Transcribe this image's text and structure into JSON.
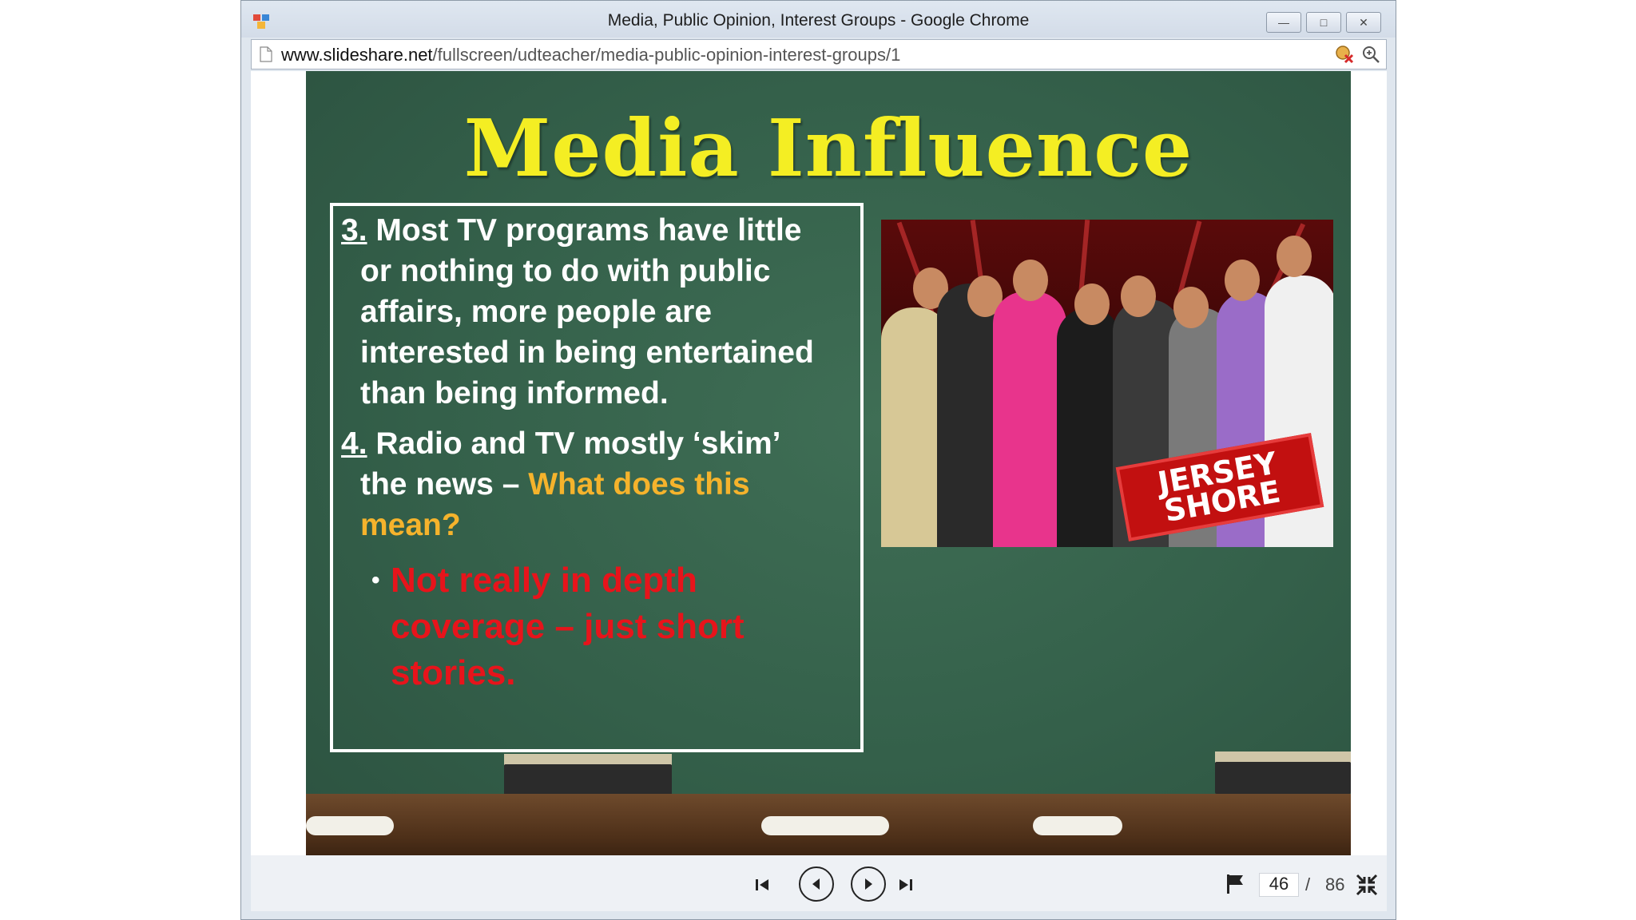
{
  "browser": {
    "window_title": "Media, Public Opinion, Interest Groups - Google Chrome",
    "url_host": "www.slideshare.net",
    "url_path": "/fullscreen/udteacher/media-public-opinion-interest-groups/1",
    "buttons": {
      "minimize": "minimize",
      "maximize": "restore",
      "close": "close"
    }
  },
  "slide": {
    "title": "Media Influence",
    "point3_num": "3.",
    "point3_line1": " Most TV programs have little",
    "point3_rest": "or  nothing to do with public affairs, more people are interested in being entertained than being informed.",
    "point4_num": "4.",
    "point4_line1": " Radio and TV mostly ‘skim’",
    "point4_rest_a": "the news – ",
    "point4_rest_question": "What does this mean?",
    "sub_bullet": "Not really in depth coverage – just short stories.",
    "photo_logo_line1": "JERSEY",
    "photo_logo_line2": "SHORE"
  },
  "player": {
    "current_page": "46",
    "separator": "/",
    "total_pages": "86"
  },
  "colors": {
    "slide_bg": "#34604a",
    "title": "#f4ee23",
    "question": "#f5b32c",
    "answer": "#e7141b"
  }
}
